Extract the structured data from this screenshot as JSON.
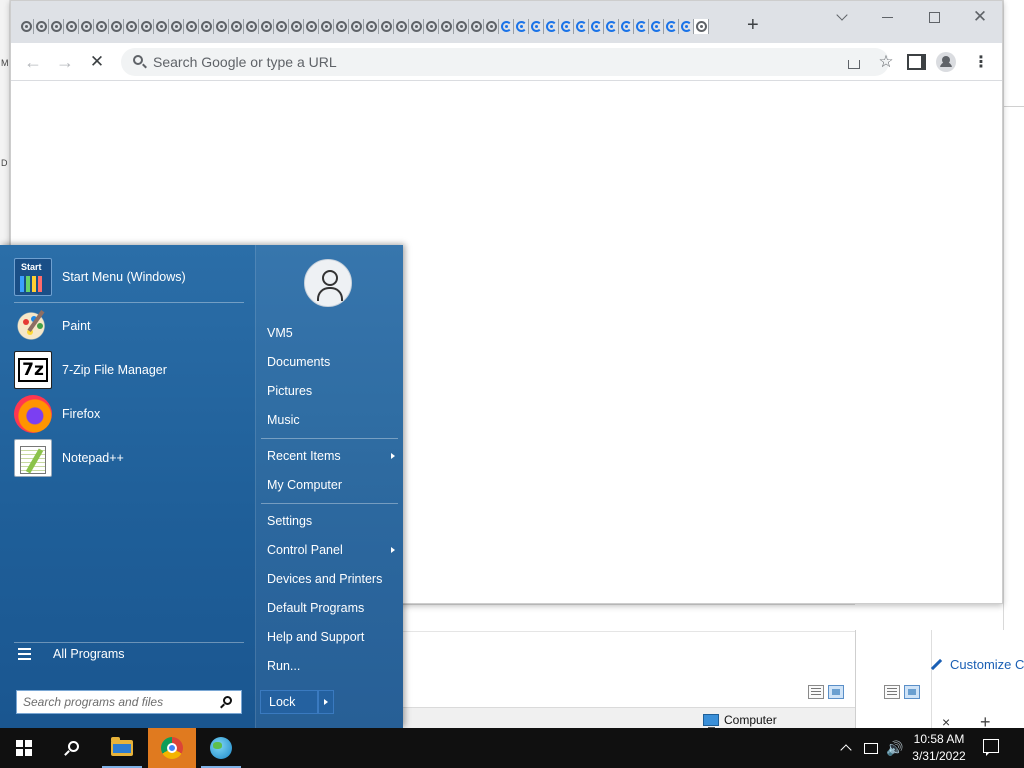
{
  "background": {
    "left_strip_letters": [
      "M",
      "D"
    ],
    "explorer": {
      "location_label": "Computer",
      "customize_label": "Customize C",
      "close_glyph": "×",
      "newtab_glyph": "+",
      "scroll_glyph": "▾"
    }
  },
  "browser": {
    "tab_count": 46,
    "loading_tab_range": [
      32,
      44
    ],
    "active_tab_index": 45,
    "newtab_glyph": "+",
    "window_controls": {
      "tab_search": "",
      "minimize": "",
      "maximize": "",
      "close": "✕"
    },
    "nav": {
      "back": "←",
      "forward": "→",
      "stop": "✕"
    },
    "omnibox": {
      "placeholder": "Search Google or type a URL",
      "value": ""
    },
    "actions": {
      "star": "☆",
      "menu": "⋮"
    },
    "colors": {
      "titlebar": "#dee1e6",
      "omnibox": "#f1f3f4",
      "accent": "#1a73e8"
    }
  },
  "start_menu": {
    "pinned": [
      {
        "label": "Start Menu (Windows)",
        "icon": "start-menu-icon"
      },
      {
        "label": "Paint",
        "icon": "paint-icon"
      },
      {
        "label": "7-Zip File Manager",
        "icon": "7zip-icon"
      },
      {
        "label": "Firefox",
        "icon": "firefox-icon"
      },
      {
        "label": "Notepad++",
        "icon": "notepad-plus-plus-icon"
      }
    ],
    "start_icon_text": "Start",
    "sevenzip_icon_text": "7z",
    "all_programs": "All Programs",
    "search_placeholder": "Search programs and files",
    "right": {
      "user": "VM5",
      "documents": "Documents",
      "pictures": "Pictures",
      "music": "Music",
      "recent_items": "Recent Items",
      "my_computer": "My Computer",
      "settings": "Settings",
      "control_panel": "Control Panel",
      "devices_printers": "Devices and Printers",
      "default_programs": "Default Programs",
      "help_support": "Help and Support",
      "run": "Run..."
    },
    "lock": "Lock",
    "colors": {
      "panel": "#1f5f99",
      "text": "#ffffff"
    }
  },
  "taskbar": {
    "apps": [
      "start-button",
      "search",
      "file-explorer",
      "chrome",
      "network-globe"
    ],
    "active_app": "chrome",
    "tray": {
      "volume": "🔊"
    },
    "time": "10:58 AM",
    "date": "3/31/2022",
    "colors": {
      "background": "#101010",
      "active_app": "#e07a1f"
    }
  }
}
